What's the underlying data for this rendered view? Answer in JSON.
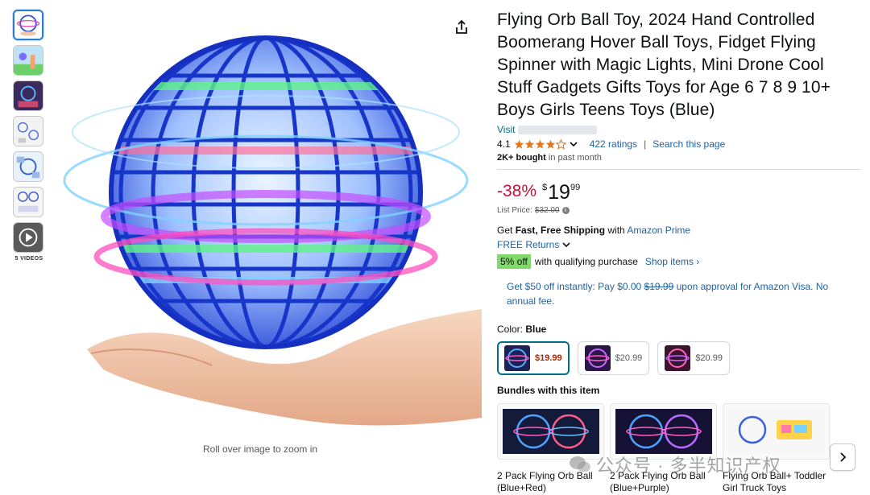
{
  "gallery": {
    "videos_label": "5 VIDEOS",
    "zoom_hint": "Roll over image to zoom in"
  },
  "product": {
    "title": "Flying Orb Ball Toy, 2024 Hand Controlled Boomerang Hover Ball Toys, Fidget Flying Spinner with Magic Lights, Mini Drone Cool Stuff Gadgets Gifts Toys for Age 6 7 8 9 10+ Boys Girls Teens Toys (Blue)",
    "visit_label": "Visit",
    "rating": "4.1",
    "rating_stars": 4.1,
    "ratings_count": "422 ratings",
    "search_page": "Search this page",
    "bought_bold": "2K+ bought",
    "bought_rest": " in past month"
  },
  "price": {
    "discount": "-38%",
    "currency": "$",
    "whole": "19",
    "fraction": "99",
    "list_label": "List Price:",
    "list_value": "$32.00"
  },
  "shipping": {
    "get": "Get ",
    "bold": "Fast, Free Shipping",
    "with": " with ",
    "prime": "Amazon Prime",
    "free_returns": "FREE Returns"
  },
  "coupon": {
    "badge": "5% off",
    "text": "with qualifying purchase",
    "shop_items": "Shop items ›"
  },
  "visa_offer": {
    "before": "Get $50 off instantly: Pay $0.00 ",
    "strike": "$19.99",
    "after": " upon approval for Amazon Visa. No annual fee."
  },
  "color": {
    "label": "Color: ",
    "selected": "Blue",
    "options": [
      {
        "price": "$19.99"
      },
      {
        "price": "$20.99"
      },
      {
        "price": "$20.99"
      }
    ]
  },
  "bundles": {
    "label": "Bundles with this item",
    "items": [
      {
        "name": "2 Pack Flying Orb Ball (Blue+Red)"
      },
      {
        "name": "2 Pack Flying Orb Ball (Blue+Purple)"
      },
      {
        "name": "Flying Orb Ball+ Toddler Girl Truck Toys"
      }
    ]
  },
  "watermark": {
    "text": "公众号 · 多半知识产权"
  },
  "colors": {
    "link": "#2162a1",
    "deal_red": "#cc0c39",
    "star": "#de7921",
    "coupon_green": "#7fda69"
  }
}
